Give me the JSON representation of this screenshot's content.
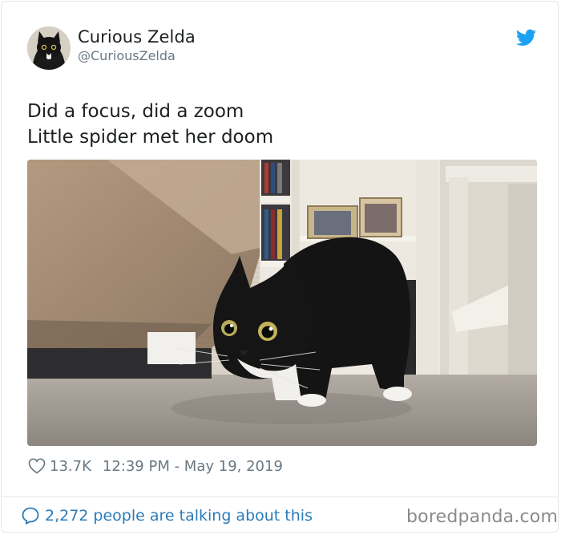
{
  "tweet": {
    "display_name": "Curious Zelda",
    "handle": "@CuriousZelda",
    "text_lines": [
      "Did a focus, did a zoom",
      "Little spider met her doom"
    ],
    "likes": "13.7K",
    "timestamp": "12:39 PM - May 19, 2019"
  },
  "footer": {
    "talking_text": "2,272 people are talking about this",
    "watermark": "boredpanda.com"
  },
  "colors": {
    "twitter_blue": "#1da1f2",
    "link_blue": "#2b7bb9",
    "meta_gray": "#697882"
  },
  "icons": {
    "logo": "twitter-bird-icon",
    "like": "heart-icon",
    "reply": "speech-bubble-icon"
  }
}
